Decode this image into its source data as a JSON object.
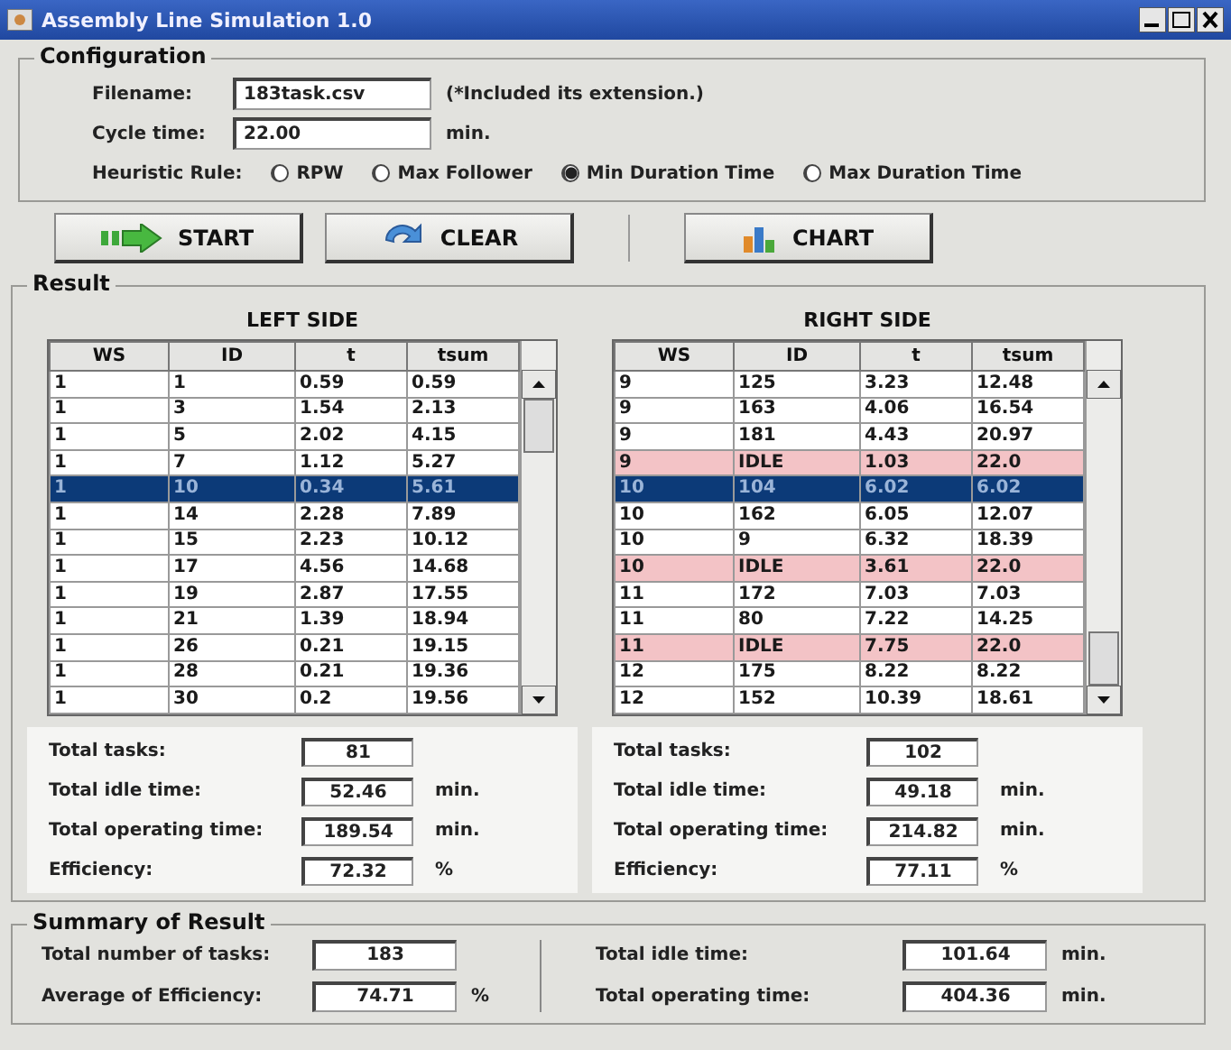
{
  "window": {
    "title": "Assembly Line Simulation 1.0"
  },
  "configuration": {
    "title": "Configuration",
    "fields": [
      {
        "label": "Filename:",
        "value": "183task.csv",
        "note": "(*Included its extension.)"
      },
      {
        "label": "Cycle time:",
        "value": "22.00",
        "note": "min."
      }
    ],
    "heuristic": {
      "label": "Heuristic Rule:",
      "options": [
        {
          "label": "RPW",
          "selected": false
        },
        {
          "label": "Max Follower",
          "selected": false
        },
        {
          "label": "Min Duration Time",
          "selected": true
        },
        {
          "label": "Max Duration Time",
          "selected": false
        }
      ]
    }
  },
  "buttons": [
    {
      "label": "START",
      "kind": "start"
    },
    {
      "label": "CLEAR",
      "kind": "clear"
    },
    {
      "label": "CHART",
      "kind": "chart"
    }
  ],
  "result": {
    "title": "Result",
    "sides": [
      {
        "title": "LEFT SIDE",
        "columns": [
          "WS",
          "ID",
          "t",
          "tsum"
        ],
        "rows": [
          {
            "cells": [
              "1",
              "1",
              "0.59",
              "0.59"
            ],
            "selected": false,
            "idle": false
          },
          {
            "cells": [
              "1",
              "3",
              "1.54",
              "2.13"
            ],
            "selected": false,
            "idle": false
          },
          {
            "cells": [
              "1",
              "5",
              "2.02",
              "4.15"
            ],
            "selected": false,
            "idle": false
          },
          {
            "cells": [
              "1",
              "7",
              "1.12",
              "5.27"
            ],
            "selected": false,
            "idle": false
          },
          {
            "cells": [
              "1",
              "10",
              "0.34",
              "5.61"
            ],
            "selected": true,
            "idle": false
          },
          {
            "cells": [
              "1",
              "14",
              "2.28",
              "7.89"
            ],
            "selected": false,
            "idle": false
          },
          {
            "cells": [
              "1",
              "15",
              "2.23",
              "10.12"
            ],
            "selected": false,
            "idle": false
          },
          {
            "cells": [
              "1",
              "17",
              "4.56",
              "14.68"
            ],
            "selected": false,
            "idle": false
          },
          {
            "cells": [
              "1",
              "19",
              "2.87",
              "17.55"
            ],
            "selected": false,
            "idle": false
          },
          {
            "cells": [
              "1",
              "21",
              "1.39",
              "18.94"
            ],
            "selected": false,
            "idle": false
          },
          {
            "cells": [
              "1",
              "26",
              "0.21",
              "19.15"
            ],
            "selected": false,
            "idle": false
          },
          {
            "cells": [
              "1",
              "28",
              "0.21",
              "19.36"
            ],
            "selected": false,
            "idle": false
          },
          {
            "cells": [
              "1",
              "30",
              "0.2",
              "19.56"
            ],
            "selected": false,
            "idle": false
          }
        ],
        "stats": [
          {
            "label": "Total tasks:",
            "value": "81"
          },
          {
            "label": "Total idle time:",
            "value": "52.46",
            "unit": "min."
          },
          {
            "label": "Total operating time:",
            "value": "189.54",
            "unit": "min."
          },
          {
            "label": "Efficiency:",
            "value": "72.32",
            "unit": "%"
          }
        ]
      },
      {
        "title": "RIGHT SIDE",
        "columns": [
          "WS",
          "ID",
          "t",
          "tsum"
        ],
        "rows": [
          {
            "cells": [
              "9",
              "125",
              "3.23",
              "12.48"
            ],
            "selected": false,
            "idle": false
          },
          {
            "cells": [
              "9",
              "163",
              "4.06",
              "16.54"
            ],
            "selected": false,
            "idle": false
          },
          {
            "cells": [
              "9",
              "181",
              "4.43",
              "20.97"
            ],
            "selected": false,
            "idle": false
          },
          {
            "cells": [
              "9",
              "IDLE",
              "1.03",
              "22.0"
            ],
            "selected": false,
            "idle": true
          },
          {
            "cells": [
              "10",
              "104",
              "6.02",
              "6.02"
            ],
            "selected": true,
            "idle": false
          },
          {
            "cells": [
              "10",
              "162",
              "6.05",
              "12.07"
            ],
            "selected": false,
            "idle": false
          },
          {
            "cells": [
              "10",
              "9",
              "6.32",
              "18.39"
            ],
            "selected": false,
            "idle": false
          },
          {
            "cells": [
              "10",
              "IDLE",
              "3.61",
              "22.0"
            ],
            "selected": false,
            "idle": true
          },
          {
            "cells": [
              "11",
              "172",
              "7.03",
              "7.03"
            ],
            "selected": false,
            "idle": false
          },
          {
            "cells": [
              "11",
              "80",
              "7.22",
              "14.25"
            ],
            "selected": false,
            "idle": false
          },
          {
            "cells": [
              "11",
              "IDLE",
              "7.75",
              "22.0"
            ],
            "selected": false,
            "idle": true
          },
          {
            "cells": [
              "12",
              "175",
              "8.22",
              "8.22"
            ],
            "selected": false,
            "idle": false
          },
          {
            "cells": [
              "12",
              "152",
              "10.39",
              "18.61"
            ],
            "selected": false,
            "idle": false
          }
        ],
        "stats": [
          {
            "label": "Total tasks:",
            "value": "102"
          },
          {
            "label": "Total idle time:",
            "value": "49.18",
            "unit": "min."
          },
          {
            "label": "Total operating time:",
            "value": "214.82",
            "unit": "min."
          },
          {
            "label": "Efficiency:",
            "value": "77.11",
            "unit": "%"
          }
        ]
      }
    ]
  },
  "summary": {
    "title": "Summary of Result",
    "left": [
      {
        "label": "Total number of tasks:",
        "value": "183"
      },
      {
        "label": "Average of Efficiency:",
        "value": "74.71",
        "unit": "%"
      }
    ],
    "right": [
      {
        "label": "Total idle time:",
        "value": "101.64",
        "unit": "min."
      },
      {
        "label": "Total operating time:",
        "value": "404.36",
        "unit": "min."
      }
    ]
  }
}
